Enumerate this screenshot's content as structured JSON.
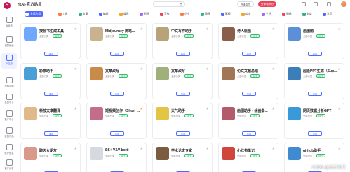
{
  "app": {
    "title": "SparkAi-官方站点",
    "logo_letter": "S"
  },
  "header": {
    "search_placeholder": "",
    "member_btn": "开通会员",
    "share_btn": "分享领积分",
    "icons": [
      "bell-icon",
      "user-icon",
      "settings-icon",
      "avatar"
    ]
  },
  "sidebar": {
    "items": [
      {
        "label": "AI对话",
        "icon": "chat-icon",
        "active": false
      },
      {
        "label": "创意绘画",
        "icon": "paint-icon",
        "active": false
      },
      {
        "label": "AI应用",
        "icon": "app-icon",
        "active": true
      },
      {
        "label": "思维导图",
        "icon": "mindmap-icon",
        "active": false
      },
      {
        "label": "会员中心",
        "icon": "member-icon",
        "active": false
      },
      {
        "label": "推广中心",
        "icon": "promote-icon",
        "active": false
      },
      {
        "label": "我的作品",
        "icon": "works-icon",
        "active": false
      },
      {
        "label": "账户信息",
        "icon": "account-icon",
        "active": false
      },
      {
        "label": "推广分享",
        "icon": "share-icon",
        "active": false
      }
    ]
  },
  "categories": [
    {
      "label": "全部应用",
      "color": "#4f6bff",
      "active": true
    },
    {
      "label": "工具",
      "color": "#ff7a45",
      "active": false
    },
    {
      "label": "文案",
      "color": "#36b37e",
      "active": false
    },
    {
      "label": "编程",
      "color": "#4f6bff",
      "active": false
    },
    {
      "label": "娱乐",
      "color": "#f5a623",
      "active": false
    },
    {
      "label": "职场",
      "color": "#9c6bff",
      "active": false
    },
    {
      "label": "写作",
      "color": "#e9445a",
      "active": false
    },
    {
      "label": "企业",
      "color": "#ff7a45",
      "active": false
    },
    {
      "label": "翻译",
      "color": "#36b37e",
      "active": false
    },
    {
      "label": "影视",
      "color": "#4f6bff",
      "active": false
    },
    {
      "label": "商务",
      "color": "#f5a623",
      "active": false
    },
    {
      "label": "生活",
      "color": "#9c6bff",
      "active": false
    },
    {
      "label": "情感",
      "color": "#e9445a",
      "active": false
    },
    {
      "label": "电商",
      "color": "#36b37e",
      "active": false
    },
    {
      "label": "学习",
      "color": "#4f6bff",
      "active": false
    }
  ],
  "cards": [
    {
      "title": "按标书生成工具",
      "meta": "全部分类",
      "badge": "GPT",
      "desc": "",
      "thumb": "#6fa8ff",
      "starred": false
    },
    {
      "title": "Midjourney 简笔...",
      "meta": "全部分类",
      "badge": "GPT",
      "desc": "",
      "thumb": "#c9b28f",
      "starred": false
    },
    {
      "title": "中文写作助手",
      "meta": "全部分类",
      "badge": "GPT",
      "desc": "",
      "thumb": "#b8a27a",
      "starred": false
    },
    {
      "title": "诗人绘画",
      "meta": "全部分类",
      "badge": "GPT",
      "desc": "",
      "thumb": "#8b5e4a",
      "starred": false
    },
    {
      "title": "画图题",
      "meta": "全部分类",
      "badge": "GPT",
      "desc": "",
      "thumb": "#5b8fd8",
      "starred": false
    },
    {
      "title": "彩票助手",
      "meta": "全部分类",
      "badge": "GPT",
      "desc": "",
      "thumb": "#4a9fd6",
      "starred": false
    },
    {
      "title": "文章改写",
      "meta": "全部分类",
      "badge": "GPT",
      "desc": "",
      "thumb": "#c98b4a",
      "starred": false
    },
    {
      "title": "文章改写",
      "meta": "全部分类",
      "badge": "GPT",
      "desc": "",
      "thumb": "#9fb07a",
      "starred": false
    },
    {
      "title": "论文文献总结",
      "meta": "全部分类",
      "badge": "GPT",
      "desc": "",
      "thumb": "#a07656",
      "starred": false
    },
    {
      "title": "超级PPT生成（Sup...",
      "meta": "全部分类",
      "badge": "GPT",
      "desc": "",
      "thumb": "#3c7fb8",
      "starred": false
    },
    {
      "title": "科技文章翻译",
      "meta": "全部分类",
      "badge": "GPT",
      "desc": "",
      "thumb": "#e0b98a",
      "starred": false
    },
    {
      "title": "短视频创作（Short V...",
      "meta": "全部分类",
      "badge": "GPT",
      "desc": "",
      "thumb": "#c46d8a",
      "starred": true
    },
    {
      "title": "天气助手",
      "meta": "全部分类",
      "badge": "GPT",
      "desc": "",
      "thumb": "#e2c544",
      "starred": false
    },
    {
      "title": "画图助手 - 绘画参...",
      "meta": "全部分类",
      "badge": "GPT",
      "desc": "",
      "thumb": "#b35b6a",
      "starred": false
    },
    {
      "title": "网页数据分析GPT",
      "meta": "全部分类",
      "badge": "GPT",
      "desc": "",
      "thumb": "#3a9ad9",
      "starred": false
    },
    {
      "title": "聊天女朋友",
      "meta": "全部分类",
      "badge": "GPT",
      "desc": "",
      "thumb": "#d99a8a",
      "starred": false
    },
    {
      "title": "SS+ V&V-botti",
      "meta": "全部分类",
      "badge": "GPT",
      "desc": "",
      "thumb": "#d5d9e0",
      "starred": false
    },
    {
      "title": "学术论文专家",
      "meta": "全部分类",
      "badge": "GPT",
      "desc": "",
      "thumb": "#7c5c3e",
      "starred": false
    },
    {
      "title": "小红书笔记",
      "meta": "全部分类",
      "badge": "GPT",
      "desc": "",
      "thumb": "#d0463c",
      "starred": false
    },
    {
      "title": "github助手",
      "meta": "全部分类",
      "badge": "GPT",
      "desc": "",
      "thumb": "#3f8ad1",
      "starred": false
    }
  ],
  "card_button_label": "使用",
  "watermark": "CSDN @白云如幻"
}
